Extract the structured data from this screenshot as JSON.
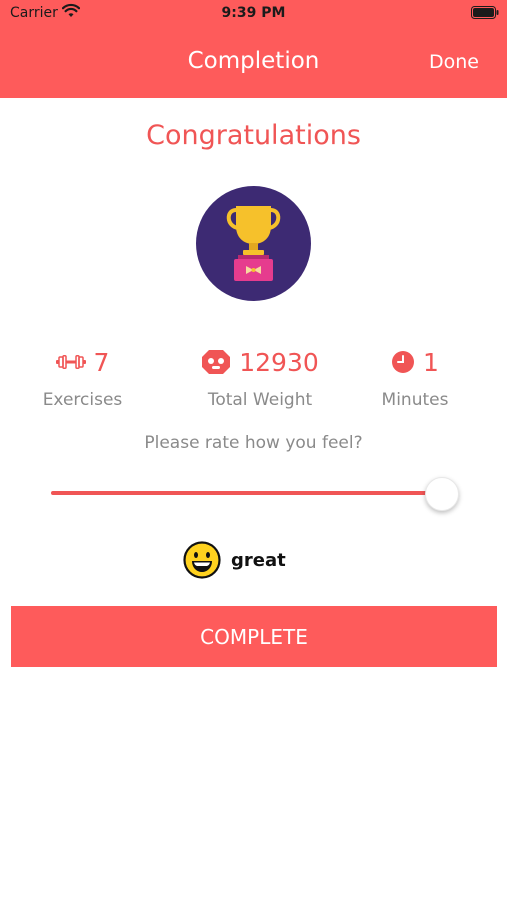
{
  "status_bar": {
    "carrier": "Carrier",
    "time": "9:39 PM"
  },
  "nav": {
    "title": "Completion",
    "done_label": "Done"
  },
  "heading": "Congratulations",
  "badge_icon": "trophy-icon",
  "stats": {
    "exercises": {
      "icon": "dumbbell-icon",
      "value": "7",
      "label": "Exercises"
    },
    "total_weight": {
      "icon": "weight-icon",
      "value": "12930",
      "label": "Total Weight"
    },
    "minutes": {
      "icon": "clock-icon",
      "value": "1",
      "label": "Minutes"
    }
  },
  "rating": {
    "prompt": "Please rate how you feel?",
    "slider_value_fraction": 1.0,
    "mood_icon": "grinning-face-icon",
    "mood_label": "great"
  },
  "complete_button_label": "COMPLETE",
  "colors": {
    "accent": "#fe5b5b",
    "text_accent": "#f05555",
    "badge_background": "#3d2a73",
    "trophy_gold": "#f6c12b",
    "pedestal_pink": "#e63c8e",
    "muted_text": "#8a8a8a"
  }
}
